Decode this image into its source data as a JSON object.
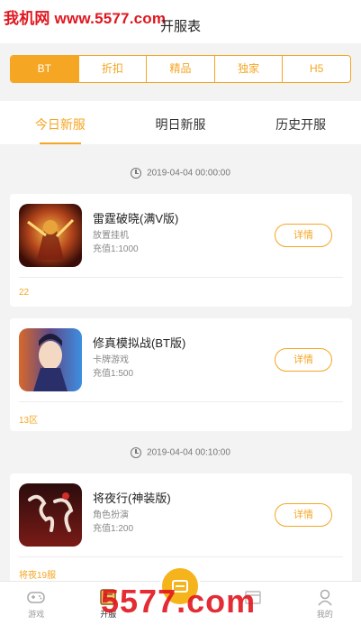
{
  "watermark": "我机网 www.5577.com",
  "page_title": "开服表",
  "category_tabs": [
    {
      "label": "BT",
      "active": true
    },
    {
      "label": "折扣",
      "active": false
    },
    {
      "label": "精品",
      "active": false
    },
    {
      "label": "独家",
      "active": false
    },
    {
      "label": "H5",
      "active": false
    }
  ],
  "sub_tabs": [
    {
      "label": "今日新服",
      "active": true
    },
    {
      "label": "明日新服",
      "active": false
    },
    {
      "label": "历史开服",
      "active": false
    }
  ],
  "time_groups": [
    {
      "time": "2019-04-04 00:00:00"
    },
    {
      "time": "2019-04-04 00:10:00"
    }
  ],
  "games": [
    {
      "name": "雷霆破晓(满V版)",
      "type": "放置挂机",
      "rate": "充值1:1000",
      "detail_label": "详情",
      "server": "22",
      "icon": "warrior-game-icon"
    },
    {
      "name": "修真模拟战(BT版)",
      "type": "卡牌游戏",
      "rate": "充值1:500",
      "detail_label": "详情",
      "server": "13区",
      "icon": "cultivation-game-icon"
    },
    {
      "name": "将夜行(神装版)",
      "type": "角色扮演",
      "rate": "充值1:200",
      "detail_label": "详情",
      "server": "将夜19服",
      "icon": "night-calligraphy-game-icon"
    }
  ],
  "bottom_nav": [
    {
      "label": "游戏",
      "icon": "gamepad-icon",
      "active": false
    },
    {
      "label": "开服",
      "icon": "server-list-icon",
      "active": true
    },
    {
      "label": "",
      "icon": "center-action-icon",
      "active": false
    },
    {
      "label": "",
      "icon": "gift-icon",
      "active": false
    },
    {
      "label": "我的",
      "icon": "user-icon",
      "active": false
    }
  ],
  "bottom_watermark": "5577.com",
  "colors": {
    "accent": "#f5a623",
    "watermark": "#e0161e"
  }
}
